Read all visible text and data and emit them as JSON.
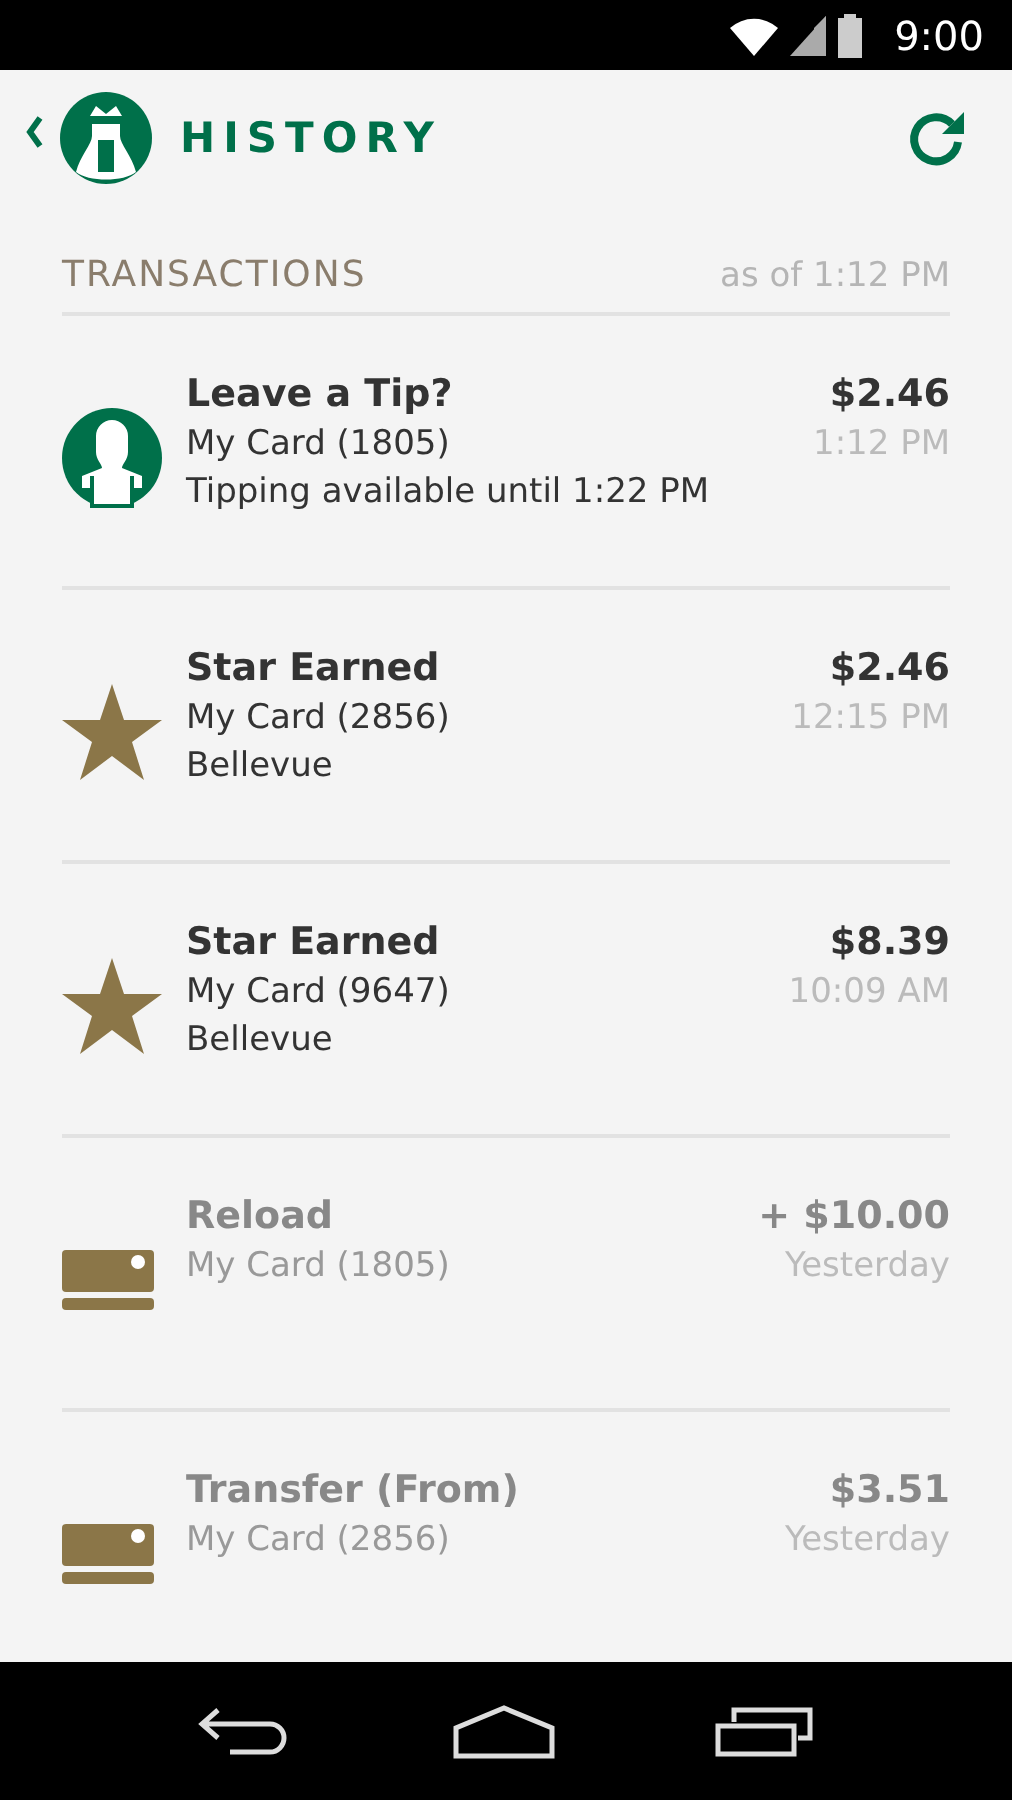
{
  "status_bar": {
    "time": "9:00"
  },
  "header": {
    "title": "HISTORY"
  },
  "section": {
    "title": "TRANSACTIONS",
    "as_of": "as of 1:12 PM"
  },
  "transactions": [
    {
      "kind": "tip",
      "title": "Leave a Tip?",
      "card": "My Card (1805)",
      "note": "Tipping available until 1:22 PM",
      "amount": "$2.46",
      "time": "1:12 PM",
      "muted": false
    },
    {
      "kind": "star",
      "title": "Star Earned",
      "card": "My Card (2856)",
      "note": "Bellevue",
      "amount": "$2.46",
      "time": "12:15 PM",
      "muted": false
    },
    {
      "kind": "star",
      "title": "Star Earned",
      "card": "My Card (9647)",
      "note": "Bellevue",
      "amount": "$8.39",
      "time": "10:09 AM",
      "muted": false
    },
    {
      "kind": "card",
      "title": "Reload",
      "card": "My Card (1805)",
      "amount": "+ $10.00",
      "time": "Yesterday",
      "muted": true
    },
    {
      "kind": "card",
      "title": "Transfer (From)",
      "card": "My Card (2856)",
      "amount": "$3.51",
      "time": "Yesterday",
      "muted": true
    }
  ]
}
